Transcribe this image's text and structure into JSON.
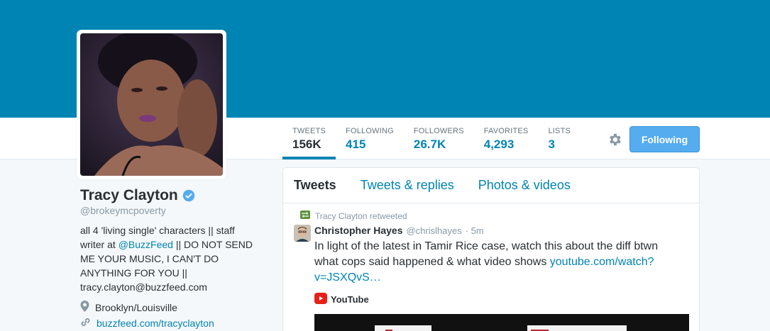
{
  "profile": {
    "name": "Tracy Clayton",
    "handle": "@brokeymcpoverty",
    "bio_part1": "all 4 'living single' characters || staff writer at ",
    "bio_mention": "@BuzzFeed",
    "bio_part2": " || DO NOT SEND ME YOUR MUSIC, I CAN'T DO ANYTHING FOR YOU || tracy.clayton@buzzfeed.com",
    "location": "Brooklyn/Louisville",
    "website": "buzzfeed.com/tracyclayton"
  },
  "stats": [
    {
      "label": "TWEETS",
      "value": "156K"
    },
    {
      "label": "FOLLOWING",
      "value": "415"
    },
    {
      "label": "FOLLOWERS",
      "value": "26.7K"
    },
    {
      "label": "FAVORITES",
      "value": "4,293"
    },
    {
      "label": "LISTS",
      "value": "3"
    }
  ],
  "follow_button": "Following",
  "tabs": [
    "Tweets",
    "Tweets & replies",
    "Photos & videos"
  ],
  "tweet": {
    "retweet_label": "Tracy Clayton retweeted",
    "author": "Christopher Hayes",
    "handle": "@chrislhayes",
    "time": "· 5m",
    "text": "In light of the latest in Tamir Rice case, watch this about the diff btwn what cops said happened & what video shows ",
    "link": "youtube.com/watch?v=JSXQvS…",
    "card_source": "YouTube"
  },
  "colors": {
    "banner": "#0084b4",
    "link": "#0084b4",
    "button": "#55acee",
    "retweet": "#5c913b"
  }
}
